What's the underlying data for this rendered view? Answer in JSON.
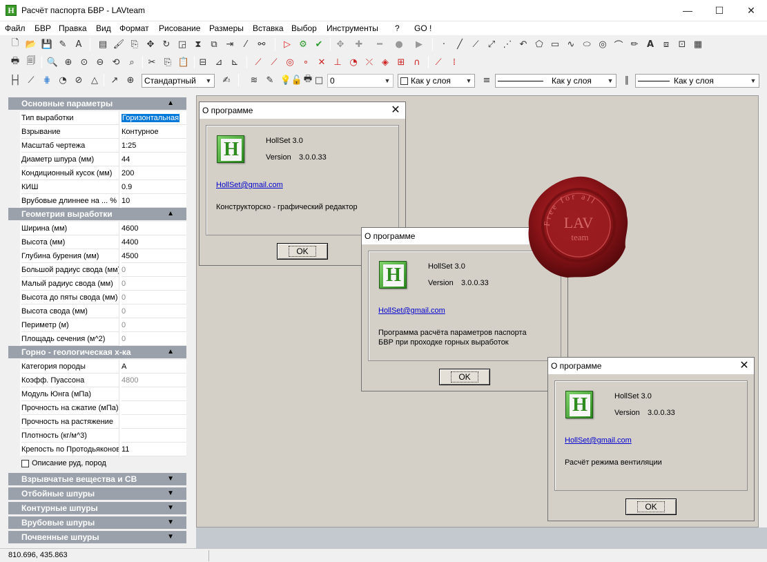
{
  "window": {
    "title": "Расчёт паспорта БВР - LAVteam",
    "icon_letter": "H",
    "minimize": "—",
    "maximize": "☐",
    "close": "✕"
  },
  "menu": [
    "Файл",
    "БВР",
    "Правка",
    "Вид",
    "Формат",
    "Рисование",
    "Размеры",
    "Вставка",
    "Выбор",
    "Инструменты",
    "?",
    "GO !"
  ],
  "toolbar": {
    "text_style": "Стандартный",
    "layer_name": "0",
    "color_label": "Как у слоя",
    "linetype_label": "Как у слоя",
    "lineweight_label": "Как у слоя"
  },
  "panel": {
    "sections": [
      {
        "title": "Основные параметры",
        "expanded": true,
        "rows": [
          {
            "name": "Тип выработки",
            "value": "Горизонтальная"
          },
          {
            "name": "Взрывание",
            "value": "Контурное"
          },
          {
            "name": "Масштаб чертежа",
            "value": "1:25"
          },
          {
            "name": "Диаметр шпура (мм)",
            "value": "44"
          },
          {
            "name": "Кондиционный кусок (мм)",
            "value": "200"
          },
          {
            "name": "КИШ",
            "value": "0.9"
          },
          {
            "name": "Врубовые длиннее на ... %",
            "value": "10"
          }
        ]
      },
      {
        "title": "Геометрия выработки",
        "expanded": true,
        "rows": [
          {
            "name": "Ширина (мм)",
            "value": "4600"
          },
          {
            "name": "Высота (мм)",
            "value": "4400"
          },
          {
            "name": "Глубина бурения (мм)",
            "value": "4500"
          },
          {
            "name": "Большой радиус свода (мм)",
            "value": "0"
          },
          {
            "name": "Малый радиус свода (мм)",
            "value": "0"
          },
          {
            "name": "Высота до пяты свода (мм)",
            "value": "0"
          },
          {
            "name": "Высота свода (мм)",
            "value": "0"
          },
          {
            "name": "Периметр (м)",
            "value": "0"
          },
          {
            "name": "Площадь сечения (м^2)",
            "value": "0"
          }
        ]
      },
      {
        "title": "Горно - геологическая х-ка",
        "expanded": true,
        "rows": [
          {
            "name": "Категория породы",
            "value": "А"
          },
          {
            "name": "Коэфф. Пуассона",
            "value": "4800"
          },
          {
            "name": "Модуль Юнга (мПа)",
            "value": ""
          },
          {
            "name": "Прочность на сжатие (мПа)",
            "value": ""
          },
          {
            "name": "Прочность на растяжение",
            "value": ""
          },
          {
            "name": "Плотность (кг/м^3)",
            "value": ""
          },
          {
            "name": "Крепость по Протодьяконову",
            "value": "11"
          }
        ]
      }
    ],
    "checkbox_label": "Описание руд, пород",
    "collapsed_sections": [
      "Взрывчатые вещества и СВ",
      "Отбойные шпуры",
      "Контурные шпуры",
      "Врубовые шпуры",
      "Почвенные шпуры"
    ]
  },
  "status": {
    "coords": "810.696,    435.863"
  },
  "dialogs": [
    {
      "title": "О программе",
      "product": "HollSet 3.0",
      "version_label": "Version",
      "version": "3.0.0.33",
      "email": "HollSet@gmail.com",
      "description": "Конструкторско - графический редактор",
      "ok": "OK"
    },
    {
      "title": "О программе",
      "product": "HollSet 3.0",
      "version_label": "Version",
      "version": "3.0.0.33",
      "email": "HollSet@gmail.com",
      "description": "Программа расчёта  параметров паспорта",
      "description2": "БВР при проходке горных выработок",
      "ok": "OK"
    },
    {
      "title": "О программе",
      "product": "HollSet 3.0",
      "version_label": "Version",
      "version": "3.0.0.33",
      "email": "HollSet@gmail.com",
      "description": "Расчёт режима вентиляции",
      "ok": "OK"
    }
  ],
  "seal": {
    "top_text": "Free for all",
    "center_text": "LAV",
    "sub_text": "team",
    "color": "#8b1418"
  }
}
